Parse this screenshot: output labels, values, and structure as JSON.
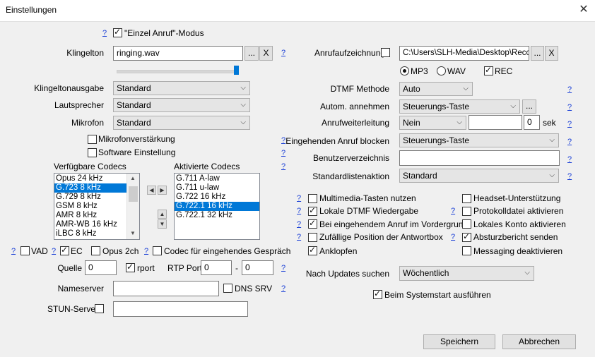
{
  "window": {
    "title": "Einstellungen"
  },
  "general": {
    "einzel_label": "\"Einzel Anruf\"-Modus",
    "help": "?"
  },
  "ringtone": {
    "label": "Klingelton",
    "value": "ringing.wav",
    "browse": "...",
    "clear": "X"
  },
  "devices": {
    "output_label": "Klingeltonausgabe",
    "output_value": "Standard",
    "speaker_label": "Lautsprecher",
    "speaker_value": "Standard",
    "mic_label": "Mikrofon",
    "mic_value": "Standard",
    "mic_boost": "Mikrofonverstärkung",
    "software_setting": "Software Einstellung"
  },
  "codecs": {
    "available_label": "Verfügbare Codecs",
    "enabled_label": "Aktivierte Codecs",
    "available": [
      "Opus 24 kHz",
      "G.723 8 kHz",
      "G.729 8 kHz",
      "GSM 8 kHz",
      "AMR 8 kHz",
      "AMR-WB 16 kHz",
      "iLBC 8 kHz"
    ],
    "enabled": [
      "G.711 A-law",
      "G.711 u-law",
      "G.722 16 kHz",
      "G.722.1 16 kHz",
      "G.722.1 32 kHz"
    ],
    "vad": "VAD",
    "ec": "EC",
    "opus2ch": "Opus 2ch",
    "incoming_codec": "Codec für eingehendes Gespräch erzw"
  },
  "network": {
    "source_label": "Quelle",
    "source_value": "0",
    "rport": "rport",
    "rtp_label": "RTP Port",
    "rtp_from": "0",
    "rtp_dash": "-",
    "rtp_to": "0",
    "nameserver_label": "Nameserver",
    "nameserver_value": "",
    "dns_srv": "DNS SRV",
    "stun_label": "STUN-Server",
    "stun_value": ""
  },
  "recording": {
    "label": "Anrufaufzeichnung",
    "path": "C:\\Users\\SLH-Media\\Desktop\\Record",
    "browse": "...",
    "clear": "X",
    "mp3": "MP3",
    "wav": "WAV",
    "rec": "REC"
  },
  "call": {
    "dtmf_label": "DTMF Methode",
    "dtmf_value": "Auto",
    "auto_answer_label": "Autom. annehmen",
    "auto_answer_value": "Steuerungs-Taste",
    "auto_answer_more": "...",
    "forward_label": "Anrufweiterleitung",
    "forward_value": "Nein",
    "forward_number": "",
    "forward_sec": "0",
    "sec_unit": "sek",
    "block_label": "Eingehenden Anruf blocken",
    "block_value": "Steuerungs-Taste",
    "userdir_label": "Benutzerverzeichnis",
    "userdir_value": "",
    "default_action_label": "Standardlistenaktion",
    "default_action_value": "Standard"
  },
  "options": {
    "multimedia_keys": "Multimedia-Tasten nutzen",
    "local_dtmf": "Lokale DTMF Wiedergabe",
    "incoming_foreground": "Bei eingehendem Anruf im Vordergrund",
    "random_position": "Zufällige Position der Antwortbox",
    "call_waiting": "Anklopfen",
    "headset_support": "Headset-Unterstützung",
    "log_file": "Protokolldatei aktivieren",
    "local_account": "Lokales Konto aktivieren",
    "crash_report": "Absturzbericht senden",
    "disable_messaging": "Messaging deaktivieren"
  },
  "updates": {
    "label": "Nach Updates suchen",
    "value": "Wöchentlich",
    "autostart": "Beim Systemstart ausführen"
  },
  "footer": {
    "save": "Speichern",
    "cancel": "Abbrechen"
  }
}
